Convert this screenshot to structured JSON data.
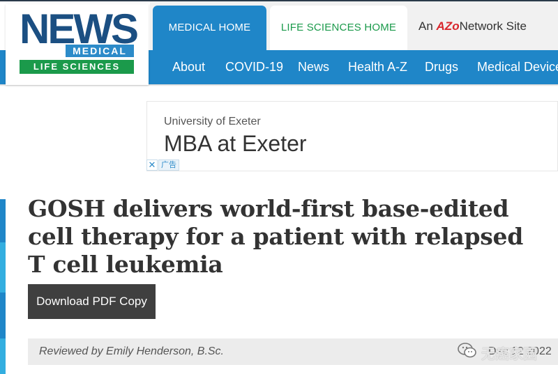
{
  "logo": {
    "word": "NEWS",
    "line2": "MEDICAL",
    "line3": "LIFE SCIENCES",
    "colors": {
      "news_blue": "#1b4f82",
      "medical_blue": "#2c8bc9",
      "life_green": "#1b9a4b"
    }
  },
  "tabs": [
    {
      "label": "MEDICAL HOME",
      "active": true
    },
    {
      "label": "LIFE SCIENCES HOME",
      "active": false
    }
  ],
  "network": {
    "prefix": "An",
    "brand_a": "AZo",
    "brand_b": "Network",
    "suffix": "Site"
  },
  "nav": [
    {
      "label": "About"
    },
    {
      "label": "COVID-19"
    },
    {
      "label": "News"
    },
    {
      "label": "Health A-Z"
    },
    {
      "label": "Drugs"
    },
    {
      "label": "Medical Devices"
    }
  ],
  "ad": {
    "sponsor": "University of Exeter",
    "headline": "MBA at Exeter",
    "close_glyph": "✕",
    "label": "广告"
  },
  "article": {
    "title": "GOSH delivers world-first base-edited cell therapy for a patient with relapsed T cell leukemia",
    "pdf_button": "Download PDF Copy",
    "reviewed_by": "Reviewed by Emily Henderson, B.Sc.",
    "date_partial": "Dec 12 2022"
  },
  "watermark": {
    "text": "无癌家园",
    "icon": "wechat-icon"
  },
  "theme": {
    "nav_blue": "#1f86c8",
    "button_dark": "#3f3f3f",
    "title_text": "#333333"
  }
}
